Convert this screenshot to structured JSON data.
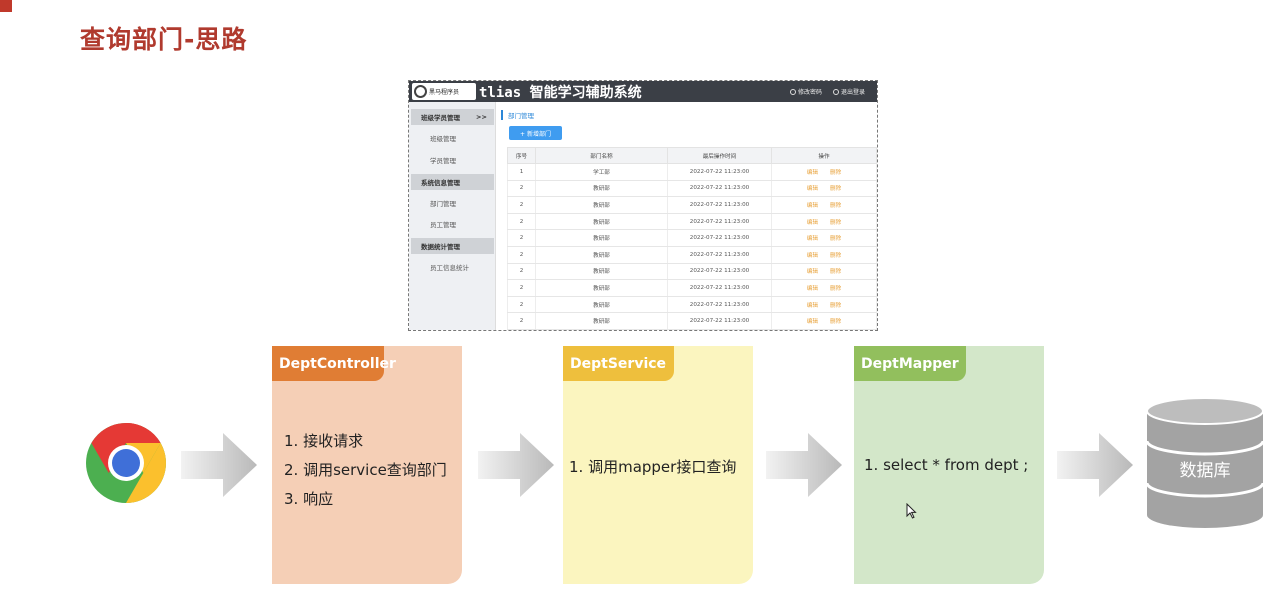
{
  "slide": {
    "title": "查询部门-思路"
  },
  "app": {
    "logo_text": "黑马程序员",
    "system_title": "tlias 智能学习辅助系统",
    "actions": {
      "change_password": "修改密码",
      "logout": "退出登录"
    },
    "sidebar": {
      "groups": [
        {
          "label": "班级学员管理",
          "suffix": ">>",
          "items": [
            "班级管理",
            "学员管理"
          ]
        },
        {
          "label": "系统信息管理",
          "items": [
            "部门管理",
            "员工管理"
          ]
        },
        {
          "label": "数据统计管理",
          "items": [
            "员工信息统计"
          ]
        }
      ]
    },
    "breadcrumb": "部门管理",
    "add_button": "+ 新增部门",
    "table": {
      "headers": [
        "序号",
        "部门名称",
        "最后操作时间",
        "操作"
      ],
      "op_labels": [
        "编辑",
        "删除"
      ],
      "rows": [
        [
          "1",
          "学工部",
          "2022-07-22 11:23:00"
        ],
        [
          "2",
          "教研部",
          "2022-07-22 11:23:00"
        ],
        [
          "2",
          "教研部",
          "2022-07-22 11:23:00"
        ],
        [
          "2",
          "教研部",
          "2022-07-22 11:23:00"
        ],
        [
          "2",
          "教研部",
          "2022-07-22 11:23:00"
        ],
        [
          "2",
          "教研部",
          "2022-07-22 11:23:00"
        ],
        [
          "2",
          "教研部",
          "2022-07-22 11:23:00"
        ],
        [
          "2",
          "教研部",
          "2022-07-22 11:23:00"
        ],
        [
          "2",
          "教研部",
          "2022-07-22 11:23:00"
        ],
        [
          "2",
          "教研部",
          "2022-07-22 11:23:00"
        ]
      ]
    }
  },
  "layers": {
    "controller": {
      "name": "DeptController",
      "color": "#e07d34",
      "steps": [
        "1.  接收请求",
        "2.  调用service查询部门",
        "3.  响应"
      ]
    },
    "service": {
      "name": "DeptService",
      "color": "#eebf3d",
      "steps": [
        "1.  调用mapper接口查询"
      ]
    },
    "mapper": {
      "name": "DeptMapper",
      "color": "#92bf5d",
      "steps": [
        "1.  select * from dept ;"
      ]
    }
  },
  "database": {
    "label": "数据库"
  },
  "icons": [
    "chrome-icon",
    "arrow-icon",
    "database-icon",
    "cursor-icon"
  ]
}
